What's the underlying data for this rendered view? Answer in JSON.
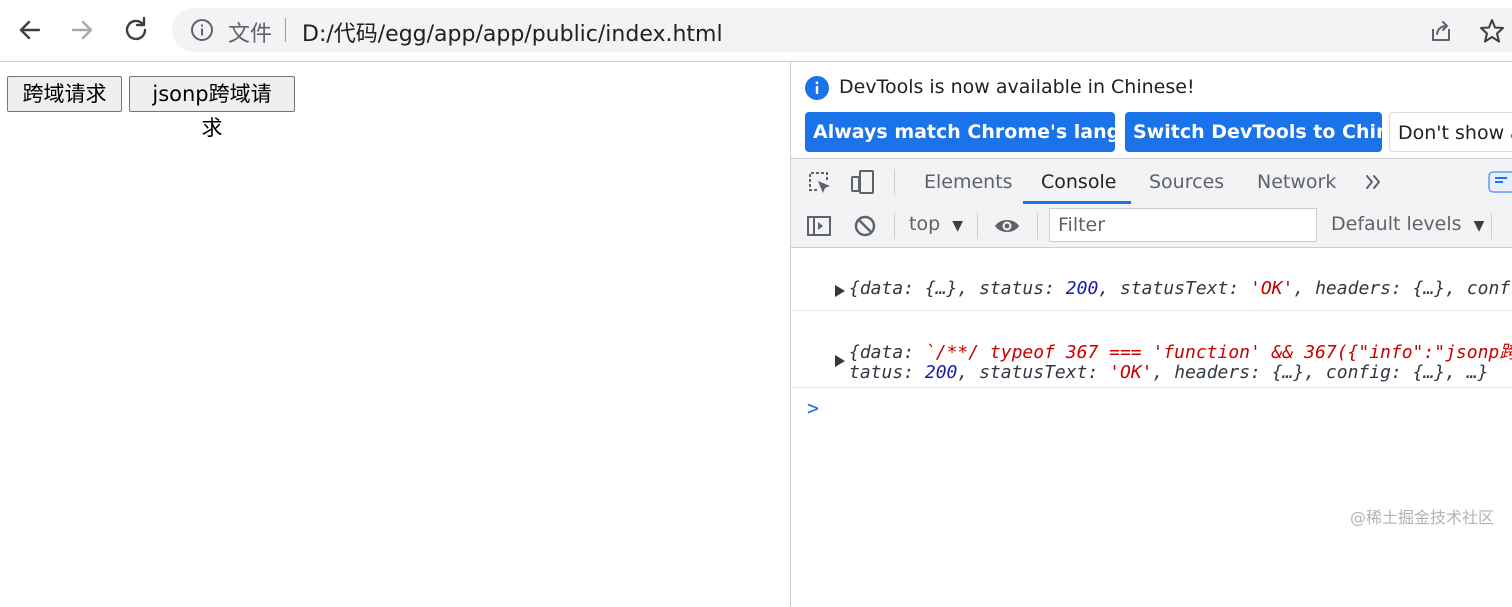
{
  "browser": {
    "url_scheme": "文件",
    "url": "D:/代码/egg/app/app/public/index.html"
  },
  "page": {
    "buttons": [
      "跨域请求",
      "jsonp跨域请求"
    ],
    "watermark": "@稀土掘金技术社区"
  },
  "devtools": {
    "banner": {
      "message": "DevTools is now available in Chinese!",
      "buttons": [
        "Always match Chrome's language",
        "Switch DevTools to Chinese",
        "Don't show a"
      ]
    },
    "tabs": [
      "Elements",
      "Console",
      "Sources",
      "Network"
    ],
    "active_tab": "Console",
    "console_bar": {
      "context": "top",
      "filter_placeholder": "Filter",
      "levels": "Default levels"
    },
    "logs": [
      {
        "segments": [
          {
            "t": "{",
            "c": "k"
          },
          {
            "t": "data",
            "c": "k"
          },
          {
            "t": ": {…}, ",
            "c": "k"
          },
          {
            "t": "status",
            "c": "k"
          },
          {
            "t": ": ",
            "c": "k"
          },
          {
            "t": "200",
            "c": "n"
          },
          {
            "t": ", ",
            "c": "k"
          },
          {
            "t": "statusText",
            "c": "k"
          },
          {
            "t": ": ",
            "c": "k"
          },
          {
            "t": "'OK'",
            "c": "s"
          },
          {
            "t": ", ",
            "c": "k"
          },
          {
            "t": "headers",
            "c": "k"
          },
          {
            "t": ": {…}, ",
            "c": "k"
          },
          {
            "t": "conf",
            "c": "k"
          }
        ]
      },
      {
        "segments": [
          {
            "t": "{",
            "c": "k"
          },
          {
            "t": "data",
            "c": "k"
          },
          {
            "t": ": ",
            "c": "k"
          },
          {
            "t": "`/**/ typeof 367 === 'function' && 367({\"info\":\"jsonp跨",
            "c": "s"
          }
        ],
        "segments2": [
          {
            "t": "tatus",
            "c": "k"
          },
          {
            "t": ": ",
            "c": "k"
          },
          {
            "t": "200",
            "c": "n"
          },
          {
            "t": ", ",
            "c": "k"
          },
          {
            "t": "statusText",
            "c": "k"
          },
          {
            "t": ": ",
            "c": "k"
          },
          {
            "t": "'OK'",
            "c": "s"
          },
          {
            "t": ", ",
            "c": "k"
          },
          {
            "t": "headers",
            "c": "k"
          },
          {
            "t": ": {…}, ",
            "c": "k"
          },
          {
            "t": "config",
            "c": "k"
          },
          {
            "t": ": {…}, …}",
            "c": "k"
          }
        ]
      }
    ],
    "prompt": ">"
  },
  "colors": {
    "accent": "#1a73e8",
    "number": "#1a1aa6",
    "string": "#c80000",
    "toolbar_bg": "#f1f3f4"
  }
}
